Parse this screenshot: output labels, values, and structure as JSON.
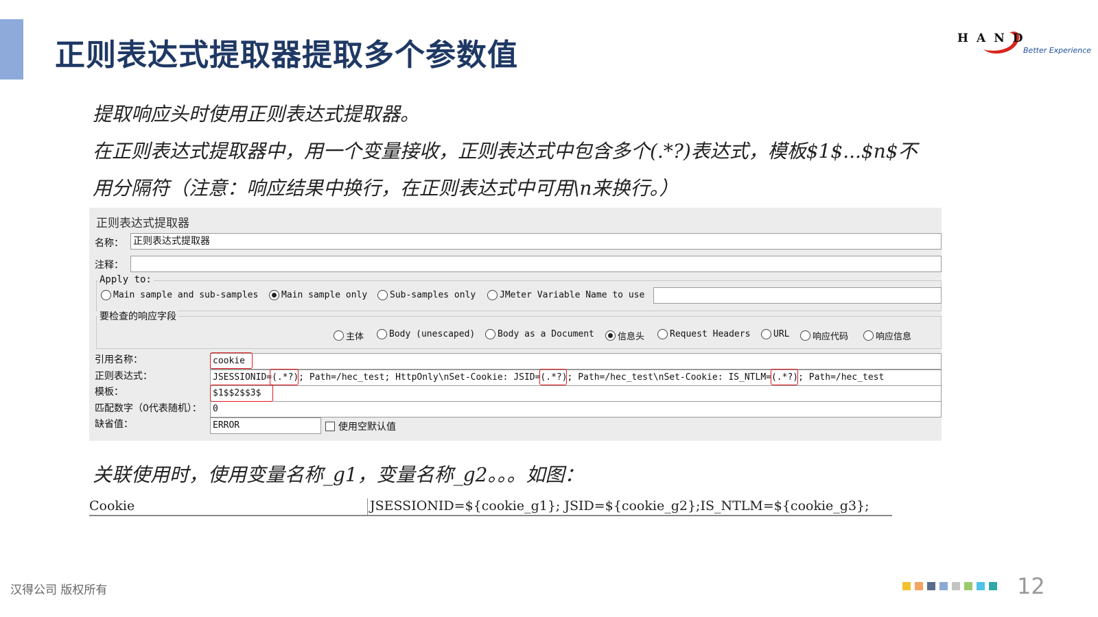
{
  "slide": {
    "title": "正则表达式提取器提取多个参数值",
    "page_number": "12",
    "footer": "汉得公司 版权所有",
    "accent_color": "#8eaadb",
    "title_color": "#1f3864"
  },
  "logo": {
    "wordmark": "HAND",
    "tagline": "Better Experience"
  },
  "body": {
    "line1": "提取响应头时使用正则表达式提取器。",
    "line2": "在正则表达式提取器中，用一个变量接收，正则表达式中包含多个(.*?)表达式，模板$1$...$n$不",
    "line3": "用分隔符（注意：响应结果中换行，在正则表达式中可用\\n来换行。）",
    "line4": "关联使用时，使用变量名称_g1，变量名称_g2。。。如图："
  },
  "panel": {
    "title": "正则表达式提取器",
    "name_label": "名称：",
    "name_value": "正则表达式提取器",
    "comment_label": "注释：",
    "comment_value": "",
    "apply_to": {
      "legend": "Apply to:",
      "options": [
        "Main sample and sub-samples",
        "Main sample only",
        "Sub-samples only",
        "JMeter Variable Name to use"
      ],
      "selected": "Main sample only",
      "variable_value": ""
    },
    "field_check": {
      "legend": "要检查的响应字段",
      "options": [
        "主体",
        "Body (unescaped)",
        "Body as a Document",
        "信息头",
        "Request Headers",
        "URL",
        "响应代码",
        "响应信息"
      ],
      "selected": "信息头"
    },
    "ref_name_label": "引用名称：",
    "ref_name_value": "cookie",
    "regex_label": "正则表达式：",
    "regex_value": "JSESSIONID=(.*?); Path=/hec_test; HttpOnly\\nSet-Cookie: JSID=(.*?); Path=/hec_test\\nSet-Cookie: IS_NTLM=(.*?); Path=/hec_test",
    "template_label": "模板：",
    "template_value": "$1$$2$$3$",
    "match_no_label": "匹配数字（0代表随机）：",
    "match_no_value": "0",
    "default_label": "缺省值：",
    "default_value": "ERROR",
    "use_empty_label": "使用空默认值",
    "highlight_color": "#e0191e"
  },
  "header_manager": {
    "name": "Cookie",
    "value": "JSESSIONID=${cookie_g1}; JSID=${cookie_g2};IS_NTLM=${cookie_g3};"
  },
  "decor_colors": [
    "#f2c12e",
    "#f4a460",
    "#5b6b8c",
    "#8aa9d6",
    "#c4c4c4",
    "#9acb6c",
    "#4fc3e8",
    "#2fa8a8"
  ]
}
